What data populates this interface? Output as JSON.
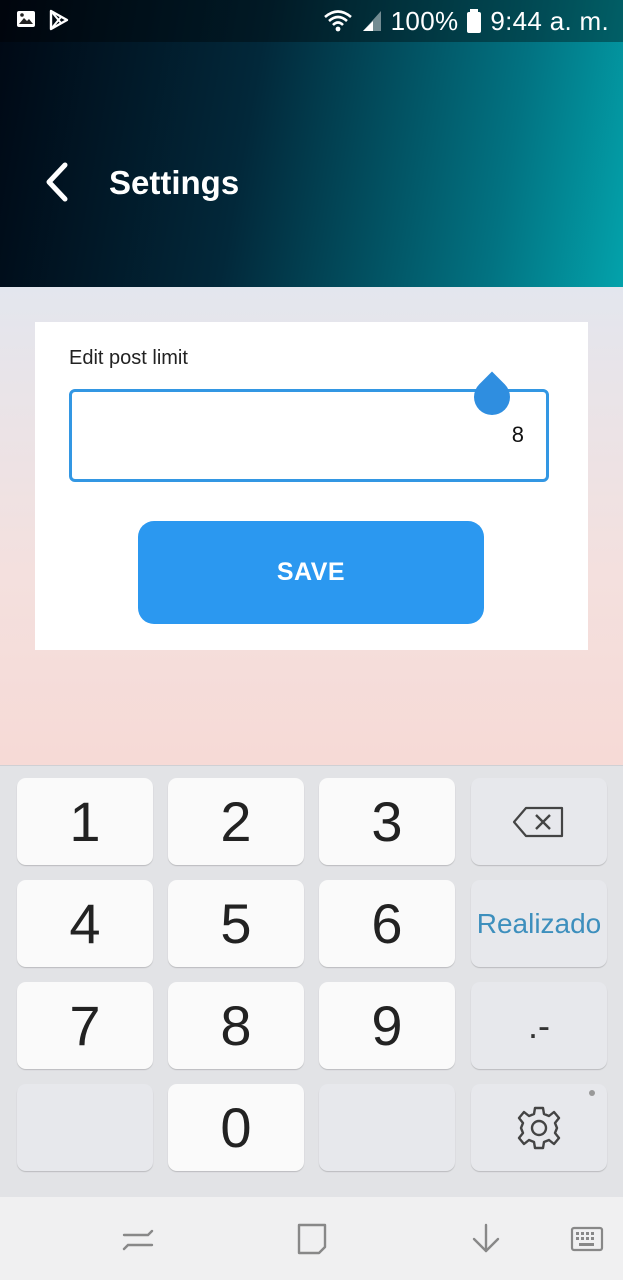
{
  "status_bar": {
    "battery": "100%",
    "time": "9:44 a. m."
  },
  "header": {
    "title": "Settings"
  },
  "form": {
    "label": "Edit post limit",
    "input_value": "8",
    "save_label": "SAVE"
  },
  "keyboard": {
    "keys": {
      "k1": "1",
      "k2": "2",
      "k3": "3",
      "k4": "4",
      "k5": "5",
      "k6": "6",
      "k7": "7",
      "k8": "8",
      "k9": "9",
      "k0": "0"
    },
    "done_label": "Realizado",
    "punct_label": ".-"
  },
  "colors": {
    "accent": "#2b98f0",
    "done_text": "#3d8fbd"
  },
  "icons": {
    "back": "back-arrow-icon",
    "backspace": "backspace-icon",
    "settings": "gear-icon",
    "nav_recents": "recents-icon",
    "nav_home": "home-icon",
    "nav_hide_keyboard": "hide-keyboard-icon",
    "nav_keyboard": "keyboard-icon"
  }
}
